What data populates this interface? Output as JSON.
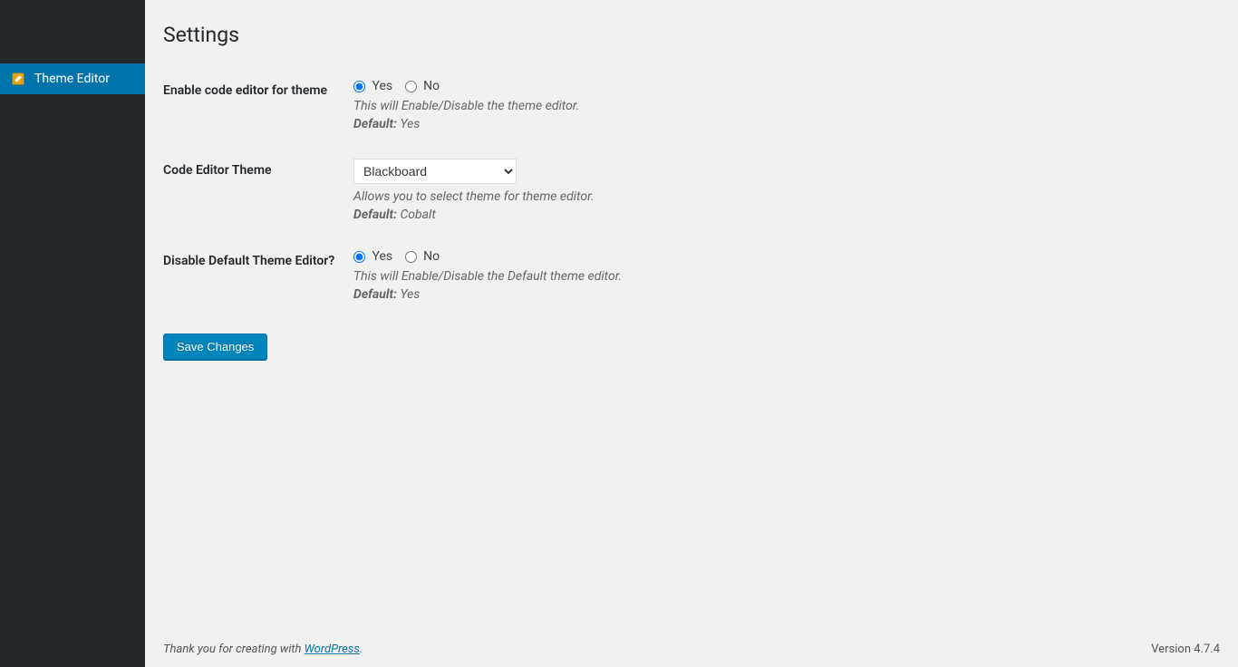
{
  "sidebar": {
    "items": [
      {
        "label": "Theme Editor"
      }
    ]
  },
  "page": {
    "title": "Settings"
  },
  "settings": {
    "enable_editor": {
      "label": "Enable code editor for theme",
      "yes": "Yes",
      "no": "No",
      "selected": "yes",
      "description": "This will Enable/Disable the theme editor.",
      "default_label": "Default:",
      "default_value": "Yes"
    },
    "code_theme": {
      "label": "Code Editor Theme",
      "selected": "Blackboard",
      "description": "Allows you to select theme for theme editor.",
      "default_label": "Default:",
      "default_value": "Cobalt"
    },
    "disable_default": {
      "label": "Disable Default Theme Editor?",
      "yes": "Yes",
      "no": "No",
      "selected": "yes",
      "description": "This will Enable/Disable the Default theme editor.",
      "default_label": "Default:",
      "default_value": "Yes"
    }
  },
  "actions": {
    "save": "Save Changes"
  },
  "footer": {
    "thanks_prefix": "Thank you for creating with ",
    "link_text": "WordPress",
    "thanks_suffix": ".",
    "version": "Version 4.7.4"
  }
}
